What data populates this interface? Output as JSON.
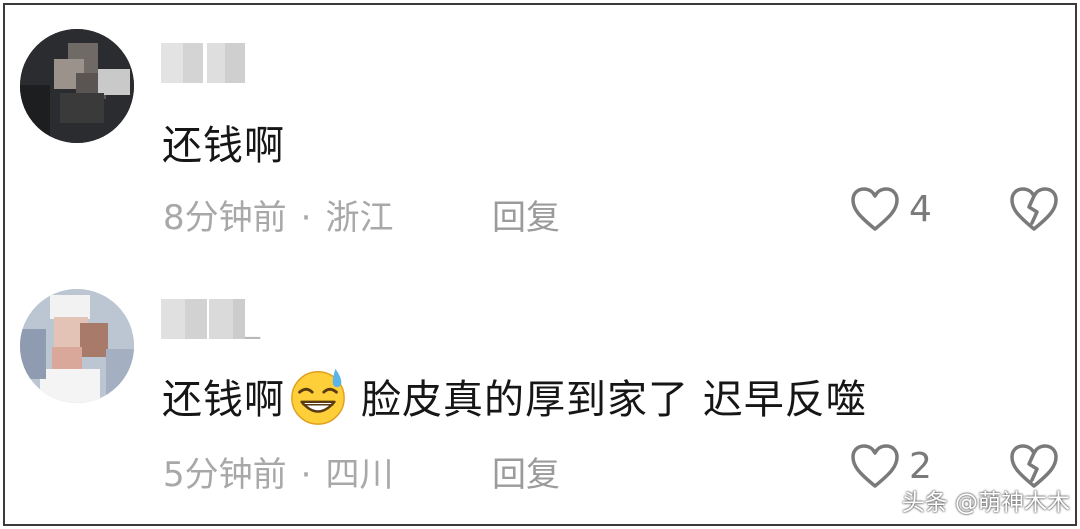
{
  "comments": [
    {
      "username": "",
      "text": "还钱啊",
      "time": "8分钟前",
      "separator": "·",
      "location": "浙江",
      "reply_label": "回复",
      "like_count": "4",
      "avatar_icon": "blurred-avatar",
      "like_icon": "heart-outline-icon",
      "dislike_icon": "broken-heart-icon"
    },
    {
      "username": "_",
      "text_before": "还钱啊",
      "emoji": "grinning-sweat-emoji",
      "text_after": "脸皮真的厚到家了 迟早反噬",
      "time": "5分钟前",
      "separator": "·",
      "location": "四川",
      "reply_label": "回复",
      "like_count": "2",
      "avatar_icon": "blurred-avatar",
      "like_icon": "heart-outline-icon",
      "dislike_icon": "broken-heart-icon"
    }
  ],
  "watermark": "头条 @萌神木木",
  "colors": {
    "text": "#161616",
    "meta": "#a8a8a8",
    "icon": "#7a7a7a",
    "border": "#3a3a3a"
  }
}
